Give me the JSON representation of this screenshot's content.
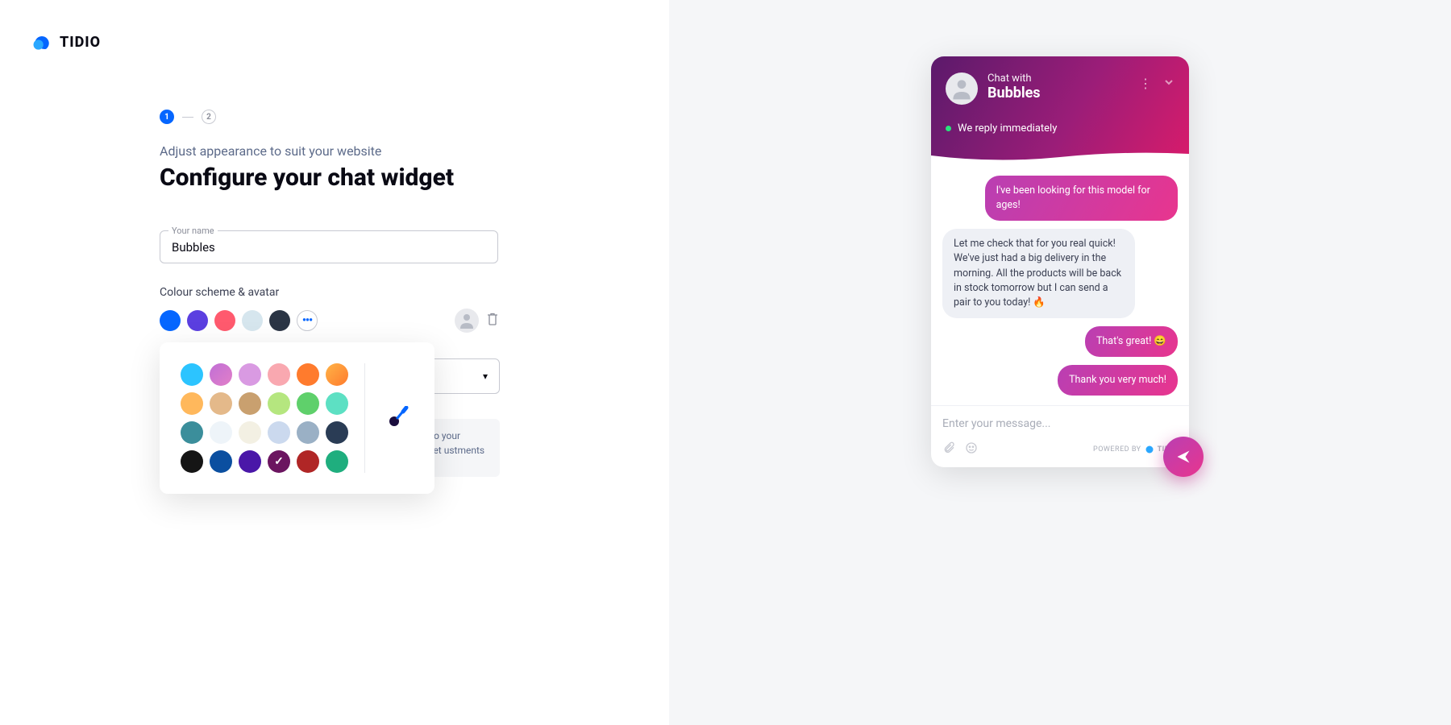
{
  "brand": {
    "name": "TIDIO"
  },
  "stepper": {
    "current": "1",
    "next": "2"
  },
  "page": {
    "subtitle": "Adjust appearance to suit your website",
    "title": "Configure your chat widget"
  },
  "name_field": {
    "label": "Your name",
    "value": "Bubbles"
  },
  "color_section": {
    "label": "Colour scheme & avatar"
  },
  "quick_colors": [
    "#0566ff",
    "#5b3fe0",
    "#ff5a6e",
    "#d6e6ee",
    "#2b3545"
  ],
  "color_grid": [
    [
      "#2cc4ff",
      "linear-gradient(135deg,#c06fd6,#e27fc8)",
      "#d99ae2",
      "#f9a8b0",
      "#ff7b2d",
      "linear-gradient(135deg,#ffb347,#ff7b2d)"
    ],
    [
      "#ffb85c",
      "#e4b98a",
      "#c9a06f",
      "#b5e67f",
      "#5fd06b",
      "#5de0c3"
    ],
    [
      "#3b8e9b",
      "#eef4f9",
      "#f3f0e3",
      "#cbd9ee",
      "#9ab0c5",
      "#2a3c55"
    ],
    [
      "#151515",
      "#0b4fa0",
      "#4a17a8",
      "#6b1560",
      "#b02626",
      "#1fae7e"
    ]
  ],
  "selected_color_index": [
    3,
    3
  ],
  "help_text": "ges to your widget ustments to",
  "chat": {
    "chat_with": "Chat with",
    "name": "Bubbles",
    "reply_status": "We reply immediately",
    "messages": [
      {
        "side": "user",
        "text": "I've been looking for this model for ages!"
      },
      {
        "side": "agent",
        "text": "Let me check that for you real quick! We've just had a big delivery in the morning. All the products will be back in stock tomorrow but I can send a pair to you today! 🔥"
      },
      {
        "side": "user",
        "text": "That's great! 😄"
      },
      {
        "side": "user",
        "text": "Thank you very much!"
      }
    ],
    "input_placeholder": "Enter your message...",
    "powered_label": "POWERED BY",
    "powered_brand": "TIDIO"
  }
}
